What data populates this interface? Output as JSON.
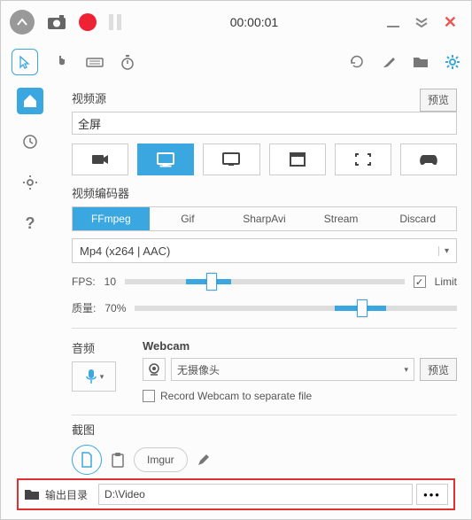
{
  "titlebar": {
    "time": "00:00:01"
  },
  "sidebar": {
    "active": "home"
  },
  "video_source": {
    "label": "视频源",
    "value": "全屏",
    "preview_btn": "预览",
    "modes": [
      "camera",
      "screen",
      "monitor",
      "window",
      "region",
      "game"
    ],
    "active_mode": "screen"
  },
  "encoder": {
    "label": "视频编码器",
    "tabs": [
      "FFmpeg",
      "Gif",
      "SharpAvi",
      "Stream",
      "Discard"
    ],
    "active": "FFmpeg",
    "codec": "Mp4 (x264 | AAC)"
  },
  "fps": {
    "label": "FPS:",
    "value": "10",
    "limit_checked": true,
    "limit_label": "Limit"
  },
  "quality": {
    "label": "质量:",
    "value": "70%"
  },
  "audio": {
    "label": "音频"
  },
  "webcam": {
    "label": "Webcam",
    "device": "无摄像头",
    "preview_btn": "预览",
    "separate_label": "Record Webcam to separate file",
    "separate_checked": false
  },
  "screenshot": {
    "label": "截图",
    "imgur": "Imgur"
  },
  "output": {
    "label": "输出目录",
    "path": "D:\\Video"
  }
}
